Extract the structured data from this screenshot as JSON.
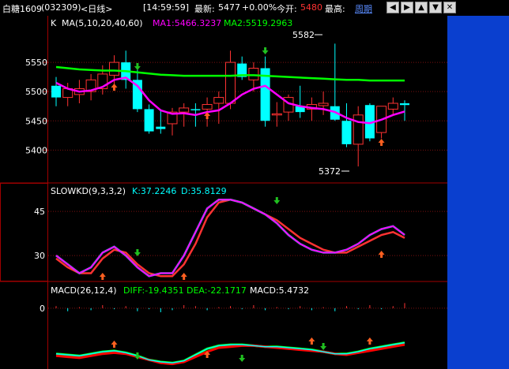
{
  "topbar": {
    "symbol": "白糖1609",
    "code": "(032309)",
    "period": "<日线>",
    "time": "[14:59:59]",
    "latest_label": "最新:",
    "latest_value": "5477",
    "change": "+0.00%",
    "open_label": "今开:",
    "open_value": "5480",
    "high_label": "最高:",
    "period_link": "周期",
    "buttons": [
      "◀",
      "▶",
      "▲",
      "▼",
      "✕"
    ]
  },
  "colors": {
    "up": "#ff3232",
    "down": "#00ffff",
    "ma1": "#ff00ff",
    "ma2": "#00ff00",
    "k": "#00ffff",
    "d": "#ff00ff",
    "diff": "#00ffff",
    "dea": "#ff0000",
    "panel_blue": "#0a3fcf"
  },
  "price_panel": {
    "title": "K",
    "ma_label": "MA(5,10,20,40,60)",
    "ma1_label": "MA1:5466.3237",
    "ma2_label": "MA2:5519.2963",
    "ticks": [
      "5550",
      "5500",
      "5450",
      "5400"
    ],
    "high_mark": "5582",
    "low_mark": "5372"
  },
  "kd_panel": {
    "title": "SLOWKD(9,3,3,2)",
    "k_label": "K:37.2246",
    "d_label": "D:35.8129",
    "ticks": [
      "45",
      "30"
    ]
  },
  "macd_panel": {
    "title": "MACD(26,12,4)",
    "diff_label": "DIFF:-19.4351",
    "dea_label": "DEA:-22.1717",
    "macd_label": "MACD:5.4732",
    "ticks": [
      "0"
    ]
  },
  "chart_data": {
    "type": "candlestick",
    "ylim_price": [
      5360,
      5600
    ],
    "candles": [
      {
        "o": 5510,
        "h": 5525,
        "l": 5475,
        "c": 5490
      },
      {
        "o": 5490,
        "h": 5515,
        "l": 5475,
        "c": 5505
      },
      {
        "o": 5495,
        "h": 5520,
        "l": 5480,
        "c": 5505
      },
      {
        "o": 5500,
        "h": 5530,
        "l": 5485,
        "c": 5520
      },
      {
        "o": 5505,
        "h": 5545,
        "l": 5495,
        "c": 5530
      },
      {
        "o": 5528,
        "h": 5562,
        "l": 5510,
        "c": 5550
      },
      {
        "o": 5550,
        "h": 5570,
        "l": 5505,
        "c": 5520
      },
      {
        "o": 5520,
        "h": 5545,
        "l": 5465,
        "c": 5470
      },
      {
        "o": 5470,
        "h": 5478,
        "l": 5428,
        "c": 5432
      },
      {
        "o": 5440,
        "h": 5470,
        "l": 5428,
        "c": 5436
      },
      {
        "o": 5445,
        "h": 5472,
        "l": 5425,
        "c": 5465
      },
      {
        "o": 5465,
        "h": 5480,
        "l": 5440,
        "c": 5472
      },
      {
        "o": 5470,
        "h": 5480,
        "l": 5440,
        "c": 5468
      },
      {
        "o": 5470,
        "h": 5490,
        "l": 5440,
        "c": 5478
      },
      {
        "o": 5480,
        "h": 5500,
        "l": 5445,
        "c": 5490
      },
      {
        "o": 5480,
        "h": 5570,
        "l": 5470,
        "c": 5550
      },
      {
        "o": 5548,
        "h": 5560,
        "l": 5520,
        "c": 5525
      },
      {
        "o": 5520,
        "h": 5550,
        "l": 5500,
        "c": 5540
      },
      {
        "o": 5540,
        "h": 5560,
        "l": 5440,
        "c": 5450
      },
      {
        "o": 5460,
        "h": 5482,
        "l": 5440,
        "c": 5462
      },
      {
        "o": 5465,
        "h": 5495,
        "l": 5450,
        "c": 5490
      },
      {
        "o": 5475,
        "h": 5510,
        "l": 5455,
        "c": 5465
      },
      {
        "o": 5470,
        "h": 5490,
        "l": 5450,
        "c": 5478
      },
      {
        "o": 5476,
        "h": 5500,
        "l": 5460,
        "c": 5480
      },
      {
        "o": 5475,
        "h": 5582,
        "l": 5450,
        "c": 5452
      },
      {
        "o": 5450,
        "h": 5480,
        "l": 5405,
        "c": 5410
      },
      {
        "o": 5410,
        "h": 5475,
        "l": 5372,
        "c": 5460
      },
      {
        "o": 5477,
        "h": 5480,
        "l": 5415,
        "c": 5420
      },
      {
        "o": 5430,
        "h": 5470,
        "l": 5420,
        "c": 5475
      },
      {
        "o": 5470,
        "h": 5490,
        "l": 5460,
        "c": 5480
      },
      {
        "o": 5480,
        "h": 5485,
        "l": 5450,
        "c": 5477
      }
    ],
    "ma1": [
      5515,
      5505,
      5500,
      5502,
      5508,
      5520,
      5524,
      5510,
      5485,
      5468,
      5462,
      5463,
      5460,
      5465,
      5468,
      5480,
      5495,
      5505,
      5510,
      5495,
      5480,
      5475,
      5472,
      5470,
      5465,
      5455,
      5448,
      5446,
      5452,
      5460,
      5466
    ],
    "ma2": [
      5542,
      5540,
      5538,
      5537,
      5536,
      5536,
      5535,
      5533,
      5531,
      5529,
      5528,
      5527,
      5527,
      5527,
      5527,
      5527,
      5528,
      5528,
      5527,
      5526,
      5525,
      5524,
      5523,
      5522,
      5521,
      5520,
      5520,
      5519,
      5519,
      5519,
      5519
    ],
    "kd_ylim": [
      22,
      52
    ],
    "k": [
      30,
      27,
      24,
      26,
      31,
      33,
      30,
      26,
      23,
      24,
      24,
      30,
      38,
      46,
      49,
      49,
      48,
      46,
      44,
      41,
      37,
      34,
      32,
      31,
      31,
      32,
      34,
      37,
      39,
      40,
      37
    ],
    "d": [
      29,
      26,
      24,
      24,
      29,
      32,
      31,
      27,
      24,
      23,
      23,
      27,
      34,
      43,
      48,
      49,
      48,
      46,
      44,
      42,
      39,
      36,
      34,
      32,
      31,
      31,
      33,
      35,
      37,
      38,
      36
    ],
    "macd_ylim": [
      -60,
      10
    ],
    "diff": [
      -45,
      -46,
      -47,
      -45,
      -43,
      -42,
      -44,
      -47,
      -51,
      -53,
      -54,
      -52,
      -46,
      -40,
      -37,
      -36,
      -36,
      -37,
      -38,
      -38,
      -39,
      -40,
      -41,
      -43,
      -45,
      -45,
      -43,
      -40,
      -38,
      -36,
      -34
    ],
    "dea": [
      -47,
      -48,
      -49,
      -47,
      -45,
      -44,
      -45,
      -48,
      -51,
      -54,
      -55,
      -53,
      -48,
      -43,
      -39,
      -38,
      -37,
      -37,
      -38,
      -39,
      -40,
      -41,
      -42,
      -43,
      -45,
      -46,
      -44,
      -42,
      -40,
      -38,
      -36
    ],
    "macd_hist": [
      2,
      -3,
      1,
      -2,
      3,
      -1,
      2,
      -3,
      -1,
      -4,
      -2,
      3,
      2,
      -2,
      1,
      2,
      -1,
      3,
      -2,
      1,
      -1,
      2,
      -2,
      1,
      -3,
      2,
      -1,
      3,
      -1,
      2,
      5
    ]
  }
}
